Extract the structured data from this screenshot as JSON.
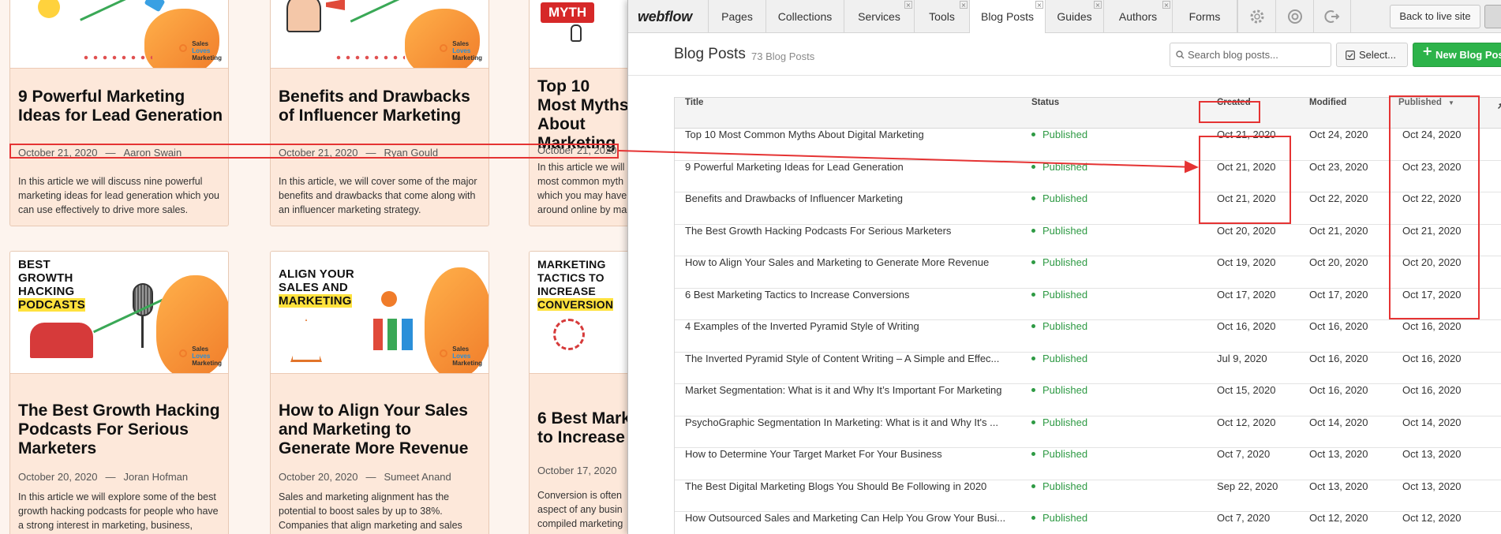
{
  "site": {
    "cards": [
      {
        "title": "9 Powerful Marketing Ideas for Lead Generation",
        "date": "October 21, 2020",
        "author": "Aaron Swain",
        "excerpt": "In this article we will discuss nine powerful marketing ideas for lead generation which you can use effectively to drive more sales."
      },
      {
        "title": "Benefits and Drawbacks of Influencer Marketing",
        "date": "October 21, 2020",
        "author": "Ryan Gould",
        "excerpt": "In this article, we will cover some of the major benefits and drawbacks that come along with an influencer marketing strategy."
      },
      {
        "title": "Top 10 Most Myths About Marketing",
        "date": "October 21, 2020",
        "author": "",
        "excerpt": "In this article we will most common myth which you may have around online by ma",
        "badge": "MYTH"
      },
      {
        "title": "The Best Growth Hacking Podcasts For Serious Marketers",
        "date": "October 20, 2020",
        "author": "Joran Hofman",
        "excerpt": "In this article we will explore some of the best growth hacking podcasts for people who have a strong interest in marketing, business,",
        "thumb_title": [
          "BEST",
          "GROWTH",
          "HACKING",
          "PODCASTS"
        ]
      },
      {
        "title": "How to Align Your Sales and Marketing to Generate More Revenue",
        "date": "October 20, 2020",
        "author": "Sumeet Anand",
        "excerpt": "Sales and marketing alignment has the potential to boost sales by up to 38%. Companies that align marketing and sales",
        "thumb_title": [
          "ALIGN YOUR",
          "SALES AND",
          "MARKETING"
        ]
      },
      {
        "title": "6 Best Mark to Increase",
        "date": "October 17, 2020",
        "author": "",
        "excerpt": "Conversion is often aspect of any busin compiled marketing",
        "thumb_title": [
          "MARKETING",
          "TACTICS TO",
          "INCREASE",
          "CONVERSION"
        ]
      }
    ],
    "brand": {
      "line1": "Sales",
      "line2": "Loves",
      "line3": "Marketing"
    }
  },
  "editor": {
    "logo": "webflow",
    "tabs": [
      "Pages",
      "Collections",
      "Services",
      "Tools",
      "Blog Posts",
      "Guides",
      "Authors",
      "Forms"
    ],
    "back_button": "Back to live site",
    "page_title": "Blog Posts",
    "post_count": "73 Blog Posts",
    "search_placeholder": "Search blog posts...",
    "select_button": "Select...",
    "new_button": "New Blog Posts",
    "columns": {
      "title": "Title",
      "status": "Status",
      "created": "Created",
      "modified": "Modified",
      "published": "Published"
    },
    "rows": [
      {
        "title": "Top 10 Most Common Myths About Digital Marketing",
        "status": "Published",
        "created": "Oct 21, 2020",
        "modified": "Oct 24, 2020",
        "published": "Oct 24, 2020"
      },
      {
        "title": "9 Powerful Marketing Ideas for Lead Generation",
        "status": "Published",
        "created": "Oct 21, 2020",
        "modified": "Oct 23, 2020",
        "published": "Oct 23, 2020"
      },
      {
        "title": "Benefits and Drawbacks of Influencer Marketing",
        "status": "Published",
        "created": "Oct 21, 2020",
        "modified": "Oct 22, 2020",
        "published": "Oct 22, 2020"
      },
      {
        "title": "The Best Growth Hacking Podcasts For Serious Marketers",
        "status": "Published",
        "created": "Oct 20, 2020",
        "modified": "Oct 21, 2020",
        "published": "Oct 21, 2020"
      },
      {
        "title": "How to Align Your Sales and Marketing to Generate More Revenue",
        "status": "Published",
        "created": "Oct 19, 2020",
        "modified": "Oct 20, 2020",
        "published": "Oct 20, 2020"
      },
      {
        "title": "6 Best Marketing Tactics to Increase Conversions",
        "status": "Published",
        "created": "Oct 17, 2020",
        "modified": "Oct 17, 2020",
        "published": "Oct 17, 2020"
      },
      {
        "title": "4 Examples of the Inverted Pyramid Style of Writing",
        "status": "Published",
        "created": "Oct 16, 2020",
        "modified": "Oct 16, 2020",
        "published": "Oct 16, 2020"
      },
      {
        "title": "The Inverted Pyramid Style of Content Writing – A Simple and Effec...",
        "status": "Published",
        "created": "Jul 9, 2020",
        "modified": "Oct 16, 2020",
        "published": "Oct 16, 2020"
      },
      {
        "title": "Market Segmentation: What is it and Why It’s Important For Marketing",
        "status": "Published",
        "created": "Oct 15, 2020",
        "modified": "Oct 16, 2020",
        "published": "Oct 16, 2020"
      },
      {
        "title": "PsychoGraphic Segmentation In Marketing: What is it and Why It's ...",
        "status": "Published",
        "created": "Oct 12, 2020",
        "modified": "Oct 14, 2020",
        "published": "Oct 14, 2020"
      },
      {
        "title": "How to Determine Your Target Market For Your Business",
        "status": "Published",
        "created": "Oct 7, 2020",
        "modified": "Oct 13, 2020",
        "published": "Oct 13, 2020"
      },
      {
        "title": "The Best Digital Marketing Blogs You Should Be Following in 2020",
        "status": "Published",
        "created": "Sep 22, 2020",
        "modified": "Oct 13, 2020",
        "published": "Oct 13, 2020"
      },
      {
        "title": "How Outsourced Sales and Marketing Can Help You Grow Your Busi...",
        "status": "Published",
        "created": "Oct 7, 2020",
        "modified": "Oct 12, 2020",
        "published": "Oct 12, 2020"
      }
    ]
  },
  "colors": {
    "accent_green": "#2db34a",
    "status_green": "#2e9a44",
    "annotation_red": "#e53333",
    "card_bg": "#fde8da"
  }
}
